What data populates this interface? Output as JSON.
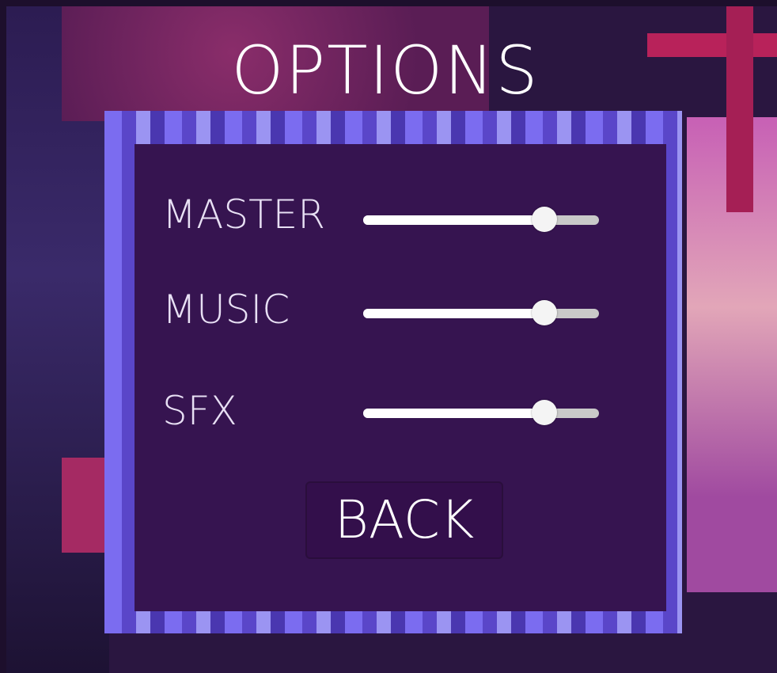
{
  "screen": {
    "title": "OPTIONS"
  },
  "sliders": [
    {
      "label": "MASTER",
      "value": 0.77
    },
    {
      "label": "MUSIC",
      "value": 0.77
    },
    {
      "label": "SFX",
      "value": 0.77
    }
  ],
  "back_button": {
    "label": "BACK"
  },
  "colors": {
    "panel": "#361450",
    "frame": "#6a5be0",
    "text": "#ffffff"
  }
}
